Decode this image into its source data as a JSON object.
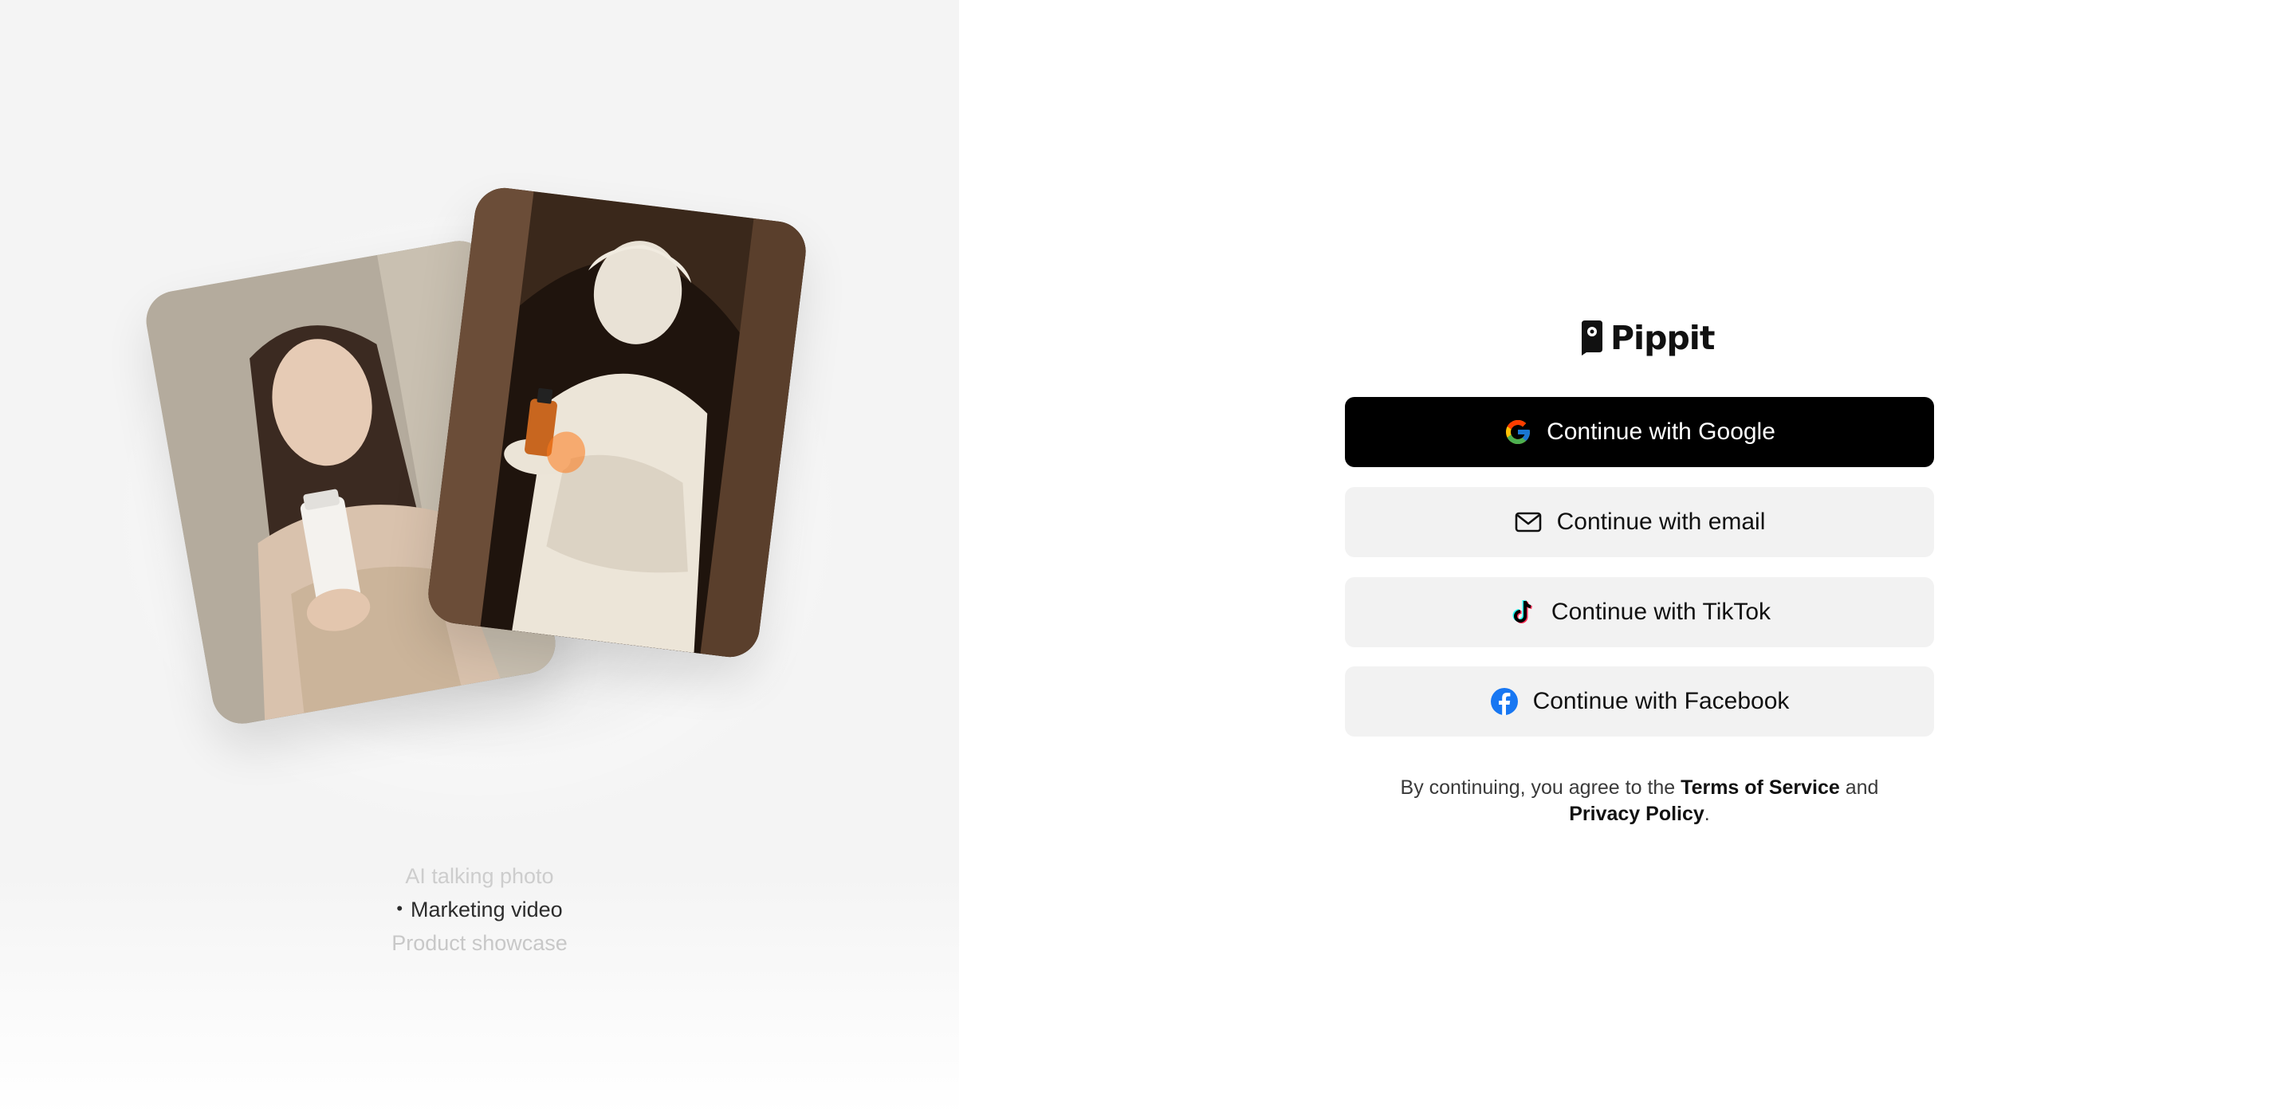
{
  "brand": {
    "name": "Pippit"
  },
  "showcase": {
    "images": [
      {
        "icon": "woman-with-cream-tube-photo"
      },
      {
        "icon": "statue-with-perfume-bottle-photo"
      }
    ],
    "captions": {
      "previous": "AI talking photo",
      "active": "Marketing video",
      "next": "Product showcase"
    },
    "active_bullet": "•"
  },
  "auth": {
    "google_label": "Continue with Google",
    "email_label": "Continue with email",
    "tiktok_label": "Continue with TikTok",
    "facebook_label": "Continue with Facebook"
  },
  "legal": {
    "prefix": "By continuing, you agree to the ",
    "terms": "Terms of Service",
    "and": " and",
    "privacy": "Privacy Policy",
    "suffix": "."
  },
  "colors": {
    "primary_button": "#000000",
    "secondary_button": "#f2f2f2",
    "left_background": "#f4f4f4",
    "facebook_blue": "#1877f2"
  }
}
